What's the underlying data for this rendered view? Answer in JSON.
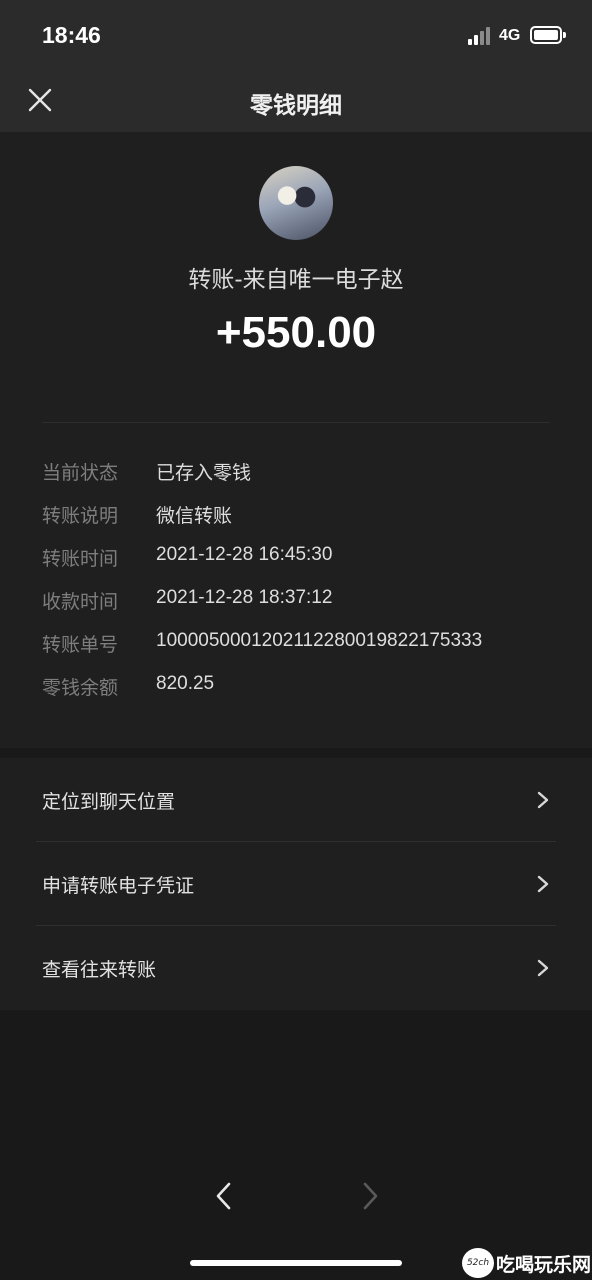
{
  "status_bar": {
    "time": "18:46",
    "network": "4G",
    "icons": [
      "signal-icon",
      "battery-icon"
    ]
  },
  "nav": {
    "title": "零钱明细",
    "close_icon": "close-icon"
  },
  "transfer": {
    "payer": "转账-来自唯一电子赵",
    "amount": "+550.00"
  },
  "details": [
    {
      "label": "当前状态",
      "value": "已存入零钱"
    },
    {
      "label": "转账说明",
      "value": "微信转账"
    },
    {
      "label": "转账时间",
      "value": "2021-12-28 16:45:30"
    },
    {
      "label": "收款时间",
      "value": "2021-12-28 18:37:12"
    },
    {
      "label": "转账单号",
      "value": "1000050001202112280019822175333"
    },
    {
      "label": "零钱余额",
      "value": "820.25"
    }
  ],
  "actions": [
    {
      "label": "定位到聊天位置"
    },
    {
      "label": "申请转账电子凭证"
    },
    {
      "label": "查看往来转账"
    }
  ],
  "browser_nav": {
    "back_icon": "chevron-left-icon",
    "forward_icon": "chevron-right-icon"
  },
  "watermark": {
    "badge": "52ch",
    "text": "吃喝玩乐网"
  },
  "colors": {
    "background": "#191919",
    "panel": "#1f1f1f",
    "bar": "#2b2b2b",
    "label": "#7e7e7e"
  }
}
